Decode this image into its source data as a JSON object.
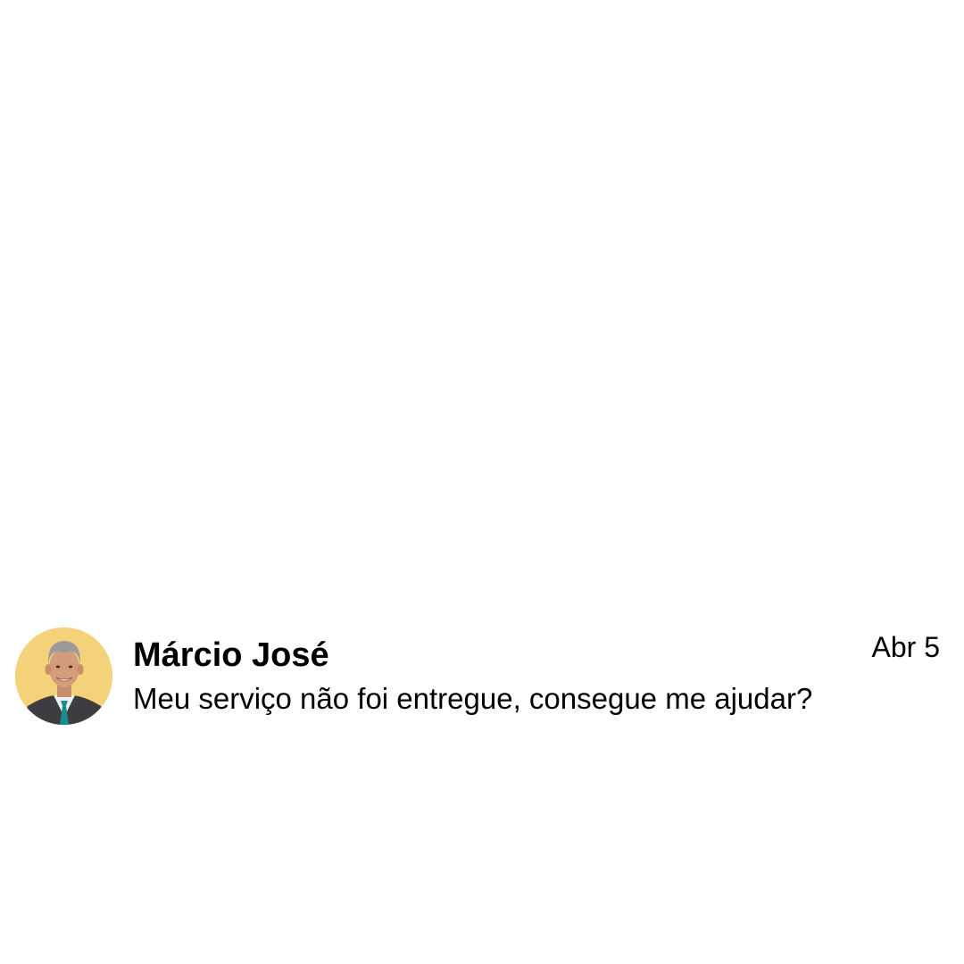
{
  "message": {
    "sender_name": "Márcio José",
    "text": "Meu serviço não foi entregue, consegue me ajudar?",
    "timestamp": "Abr 5",
    "avatar_icon": "avatar-photo",
    "avatar_background": "#f4d27a"
  }
}
